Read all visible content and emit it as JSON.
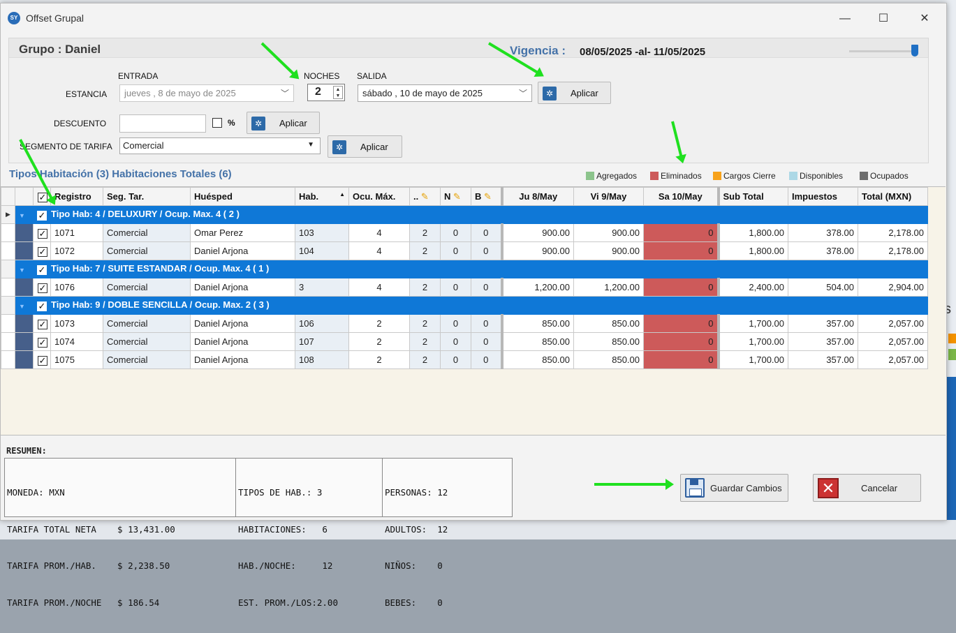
{
  "window": {
    "title": "Offset Grupal",
    "app_icon": "SY",
    "minimize": "—",
    "maximize": "☐",
    "close": "✕"
  },
  "header": {
    "group_label": "Grupo : Daniel",
    "vigencia_label": "Vigencia :",
    "vigencia_value": "08/05/2025 -al- 11/05/2025"
  },
  "form": {
    "entrada_label": "ENTRADA",
    "noches_label": "NOCHES",
    "salida_label": "SALIDA",
    "estancia_label": "ESTANCIA",
    "entrada_value": "jueves ,   8 de     mayo      de 2025",
    "noches_value": "2",
    "salida_value": "sábado , 10 de     mayo      de 2025",
    "aplicar_label": "Aplicar",
    "descuento_label": "DESCUENTO",
    "descuento_value": "",
    "percent_label": "%",
    "segmento_label": "SEGMENTO DE TARIFA",
    "segmento_value": "Comercial"
  },
  "summary_bar": {
    "tipos_text": "Tipos Habitación (3) Habitaciones Totales (6)",
    "legend": [
      {
        "label": "Agregados",
        "color": "#8cc48c"
      },
      {
        "label": "Eliminados",
        "color": "#cd5a5a"
      },
      {
        "label": "Cargos Cierre",
        "color": "#f7a21b"
      },
      {
        "label": "Disponibles",
        "color": "#add8e6"
      },
      {
        "label": "Ocupados",
        "color": "#6e6e6e"
      }
    ]
  },
  "grid": {
    "columns": {
      "registro": "Registro",
      "seg": "Seg. Tar.",
      "huesped": "Huésped",
      "hab": "Hab.",
      "ocu": "Ocu. Máx.",
      "adults": "..",
      "ninos": "N",
      "bebes": "B",
      "d1": "Ju 8/May",
      "d2": "Vi 9/May",
      "d3": "Sa 10/May",
      "sub": "Sub Total",
      "imp": "Impuestos",
      "tot": "Total (MXN)"
    },
    "groups": [
      {
        "title": "Tipo Hab: 4 / DELUXURY / Ocup. Max.  4 ( 2 )",
        "rows": [
          {
            "registro": "1071",
            "seg": "Comercial",
            "huesped": "Omar Perez",
            "hab": "103",
            "ocu": "4",
            "a": "2",
            "n": "0",
            "b": "0",
            "d1": "900.00",
            "d2": "900.00",
            "d3": "0",
            "sub": "1,800.00",
            "imp": "378.00",
            "tot": "2,178.00"
          },
          {
            "registro": "1072",
            "seg": "Comercial",
            "huesped": "Daniel Arjona",
            "hab": "104",
            "ocu": "4",
            "a": "2",
            "n": "0",
            "b": "0",
            "d1": "900.00",
            "d2": "900.00",
            "d3": "0",
            "sub": "1,800.00",
            "imp": "378.00",
            "tot": "2,178.00"
          }
        ]
      },
      {
        "title": "Tipo Hab: 7 / SUITE ESTANDAR / Ocup. Max.  4 ( 1 )",
        "rows": [
          {
            "registro": "1076",
            "seg": "Comercial",
            "huesped": "Daniel Arjona",
            "hab": "3",
            "ocu": "4",
            "a": "2",
            "n": "0",
            "b": "0",
            "d1": "1,200.00",
            "d2": "1,200.00",
            "d3": "0",
            "sub": "2,400.00",
            "imp": "504.00",
            "tot": "2,904.00"
          }
        ]
      },
      {
        "title": "Tipo Hab: 9 / DOBLE SENCILLA / Ocup. Max.  2 ( 3 )",
        "rows": [
          {
            "registro": "1073",
            "seg": "Comercial",
            "huesped": "Daniel Arjona",
            "hab": "106",
            "ocu": "2",
            "a": "2",
            "n": "0",
            "b": "0",
            "d1": "850.00",
            "d2": "850.00",
            "d3": "0",
            "sub": "1,700.00",
            "imp": "357.00",
            "tot": "2,057.00"
          },
          {
            "registro": "1074",
            "seg": "Comercial",
            "huesped": "Daniel Arjona",
            "hab": "107",
            "ocu": "2",
            "a": "2",
            "n": "0",
            "b": "0",
            "d1": "850.00",
            "d2": "850.00",
            "d3": "0",
            "sub": "1,700.00",
            "imp": "357.00",
            "tot": "2,057.00"
          },
          {
            "registro": "1075",
            "seg": "Comercial",
            "huesped": "Daniel Arjona",
            "hab": "108",
            "ocu": "2",
            "a": "2",
            "n": "0",
            "b": "0",
            "d1": "850.00",
            "d2": "850.00",
            "d3": "0",
            "sub": "1,700.00",
            "imp": "357.00",
            "tot": "2,057.00"
          }
        ]
      }
    ]
  },
  "resumen": {
    "title": "RESUMEN:",
    "col1": [
      "MONEDA: MXN",
      "TARIFA TOTAL NETA    $ 13,431.00",
      "TARIFA PROM./HAB.    $ 2,238.50",
      "TARIFA PROM./NOCHE   $ 186.54"
    ],
    "col2": [
      "TIPOS DE HAB.: 3",
      "HABITACIONES:   6",
      "HAB./NOCHE:     12",
      "EST. PROM./LOS:2.00"
    ],
    "col3": [
      "PERSONAS: 12",
      "ADULTOS:  12",
      "NIÑOS:    0",
      "BEBES:    0"
    ]
  },
  "footer": {
    "save_label": "Guardar Cambios",
    "cancel_label": "Cancelar"
  }
}
